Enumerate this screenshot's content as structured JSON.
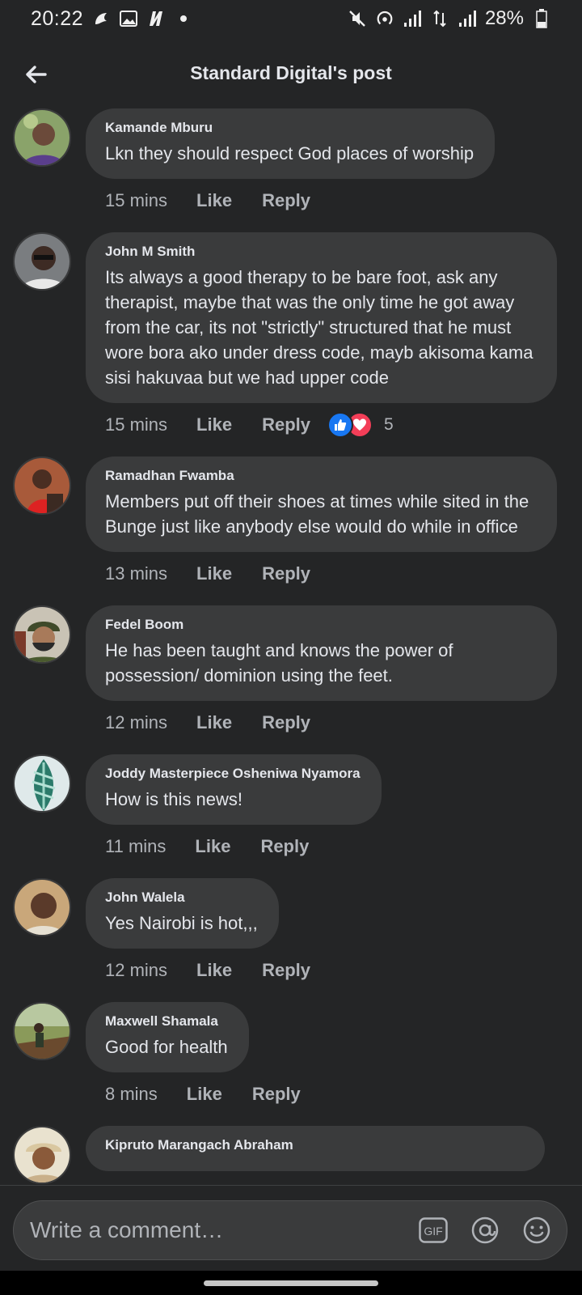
{
  "status": {
    "time": "20:22",
    "battery": "28%"
  },
  "header": {
    "title": "Standard Digital's post"
  },
  "actions": {
    "like": "Like",
    "reply": "Reply"
  },
  "comments": [
    {
      "author": "Kamande Mburu",
      "text": "Lkn they should respect God places of worship",
      "time": "15 mins"
    },
    {
      "author": "John M Smith",
      "text": "Its always a good therapy to be bare foot, ask any therapist, maybe that was the only time he got away from the car, its not \"strictly\" structured that he must wore bora ako under dress code, mayb akisoma kama sisi hakuvaa but we had upper code",
      "time": "15 mins",
      "reaction_count": "5"
    },
    {
      "author": "Ramadhan Fwamba",
      "text": "Members put off their shoes at times while sited in the Bunge just like anybody else would do while in office",
      "time": "13 mins"
    },
    {
      "author": "Fedel Boom",
      "text": "He has been taught and knows the power of possession/ dominion using the feet.",
      "time": "12 mins"
    },
    {
      "author": "Joddy Masterpiece Osheniwa Nyamora",
      "text": "How is this news!",
      "time": "11 mins"
    },
    {
      "author": "John Walela",
      "text": "Yes Nairobi is hot,,,",
      "time": "12 mins"
    },
    {
      "author": "Maxwell Shamala",
      "text": "Good for health",
      "time": "8 mins"
    },
    {
      "author": "Kipruto Marangach Abraham",
      "text": "",
      "time": ""
    }
  ],
  "composer": {
    "placeholder": "Write a comment…",
    "gif_label": "GIF"
  },
  "colors": {
    "background": "#242526",
    "bubble": "#3a3b3c",
    "like_blue": "#1877f2",
    "love_red": "#f33e58"
  }
}
